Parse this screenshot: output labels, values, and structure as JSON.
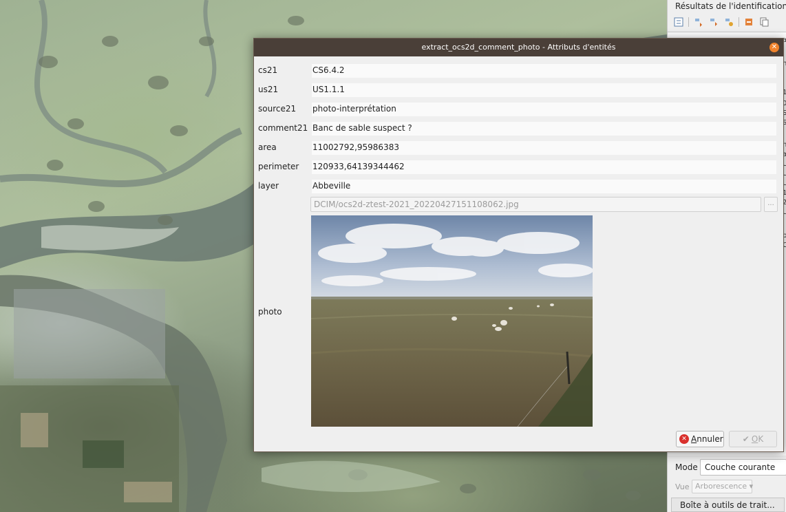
{
  "dialog": {
    "title": "extract_ocs2d_comment_photo - Attributs d'entités",
    "close_icon": "close-icon",
    "fields": [
      {
        "label": "cs21",
        "value": "CS6.4.2"
      },
      {
        "label": "us21",
        "value": "US1.1.1"
      },
      {
        "label": "source21",
        "value": "photo-interprétation"
      },
      {
        "label": "comment21",
        "value": "Banc de sable suspect ?"
      },
      {
        "label": "area",
        "value": "11002792,95986383"
      },
      {
        "label": "perimeter",
        "value": "120933,64139344462"
      },
      {
        "label": "layer",
        "value": "Abbeville"
      }
    ],
    "photo": {
      "label": "photo",
      "path": "DCIM/ocs2d-ztest-2021_20220427151108062.jpg",
      "browse_label": "..."
    },
    "buttons": {
      "cancel_prefix": "A",
      "cancel_rest": "nnuler",
      "ok_prefix": "O",
      "ok_rest": "K"
    }
  },
  "side_panel": {
    "title": "Résultats de l'identification",
    "mode_label": "Mode",
    "mode_value": "Couche courante",
    "vue_label": "Vue",
    "vue_value": "Arborescence",
    "toolbox_label": "Boîte à outils de trait...",
    "tree_fragments": [
      "a",
      "h",
      "1",
      "0",
      "S",
      "S",
      "h",
      "a",
      "U",
      "U",
      "U",
      "1",
      "2",
      "U",
      "b",
      "C"
    ]
  },
  "colors": {
    "titlebar": "#4a3f38",
    "close_accent": "#f0832c",
    "cancel_icon": "#d9302c"
  }
}
